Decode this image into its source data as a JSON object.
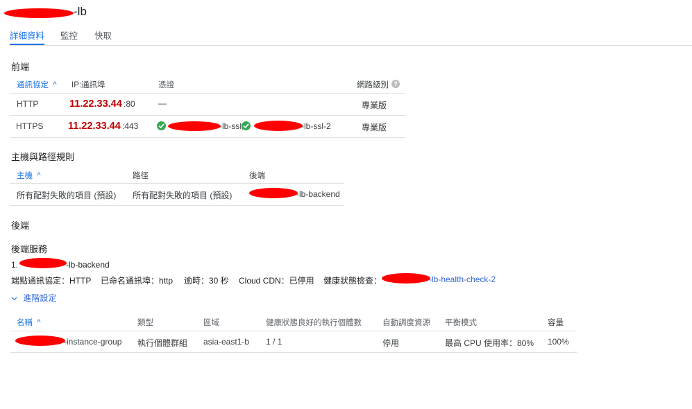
{
  "title_suffix": "-lb",
  "tabs": [
    "詳細資料",
    "監控",
    "快取"
  ],
  "frontend": {
    "heading": "前端",
    "columns": {
      "protocol": "通訊協定",
      "ip_port": "IP:通訊埠",
      "certificate": "憑證",
      "network_tier": "網路級別"
    },
    "help_glyph": "?",
    "rows": [
      {
        "protocol": "HTTP",
        "ip": "11.22.33.44",
        "port": ":80",
        "certificate": "—",
        "tier": "專業版"
      },
      {
        "protocol": "HTTPS",
        "ip": "11.22.33.44",
        "port": ":443",
        "cert1": "-lb-ssl,",
        "cert2": "-lb-ssl-2",
        "tier": "專業版"
      }
    ]
  },
  "host_path": {
    "heading": "主機與路徑規則",
    "columns": {
      "host": "主機",
      "path": "路徑",
      "backend": "後端"
    },
    "row": {
      "host": "所有配對失敗的項目 (預設)",
      "path": "所有配對失敗的項目 (預設)",
      "backend": "-lb-backend"
    }
  },
  "backend": {
    "heading": "後端",
    "services_heading": "後端服務",
    "service_index": "1.",
    "service_name": "-lb-backend",
    "details": {
      "endpoint_protocol": "端點通訊協定：HTTP",
      "named_port": "已命名通訊埠：http",
      "timeout": "逾時：30 秒",
      "cdn": "Cloud CDN：已停用",
      "health_label": "健康狀態檢查：",
      "health_check": "-lb-health-check-2"
    },
    "advanced_label": "進階設定",
    "columns": {
      "name": "名稱",
      "type": "類型",
      "region": "區域",
      "healthy": "健康狀態良好的執行個體數",
      "autoscaling": "自動調度資源",
      "balancing": "平衡模式",
      "capacity": "容量"
    },
    "row": {
      "name": "-instance-group",
      "type": "執行個體群組",
      "region": "asia-east1-b",
      "healthy": "1 / 1",
      "autoscaling": "停用",
      "balancing": "最高 CPU 使用率：80%",
      "capacity": "100%"
    }
  }
}
